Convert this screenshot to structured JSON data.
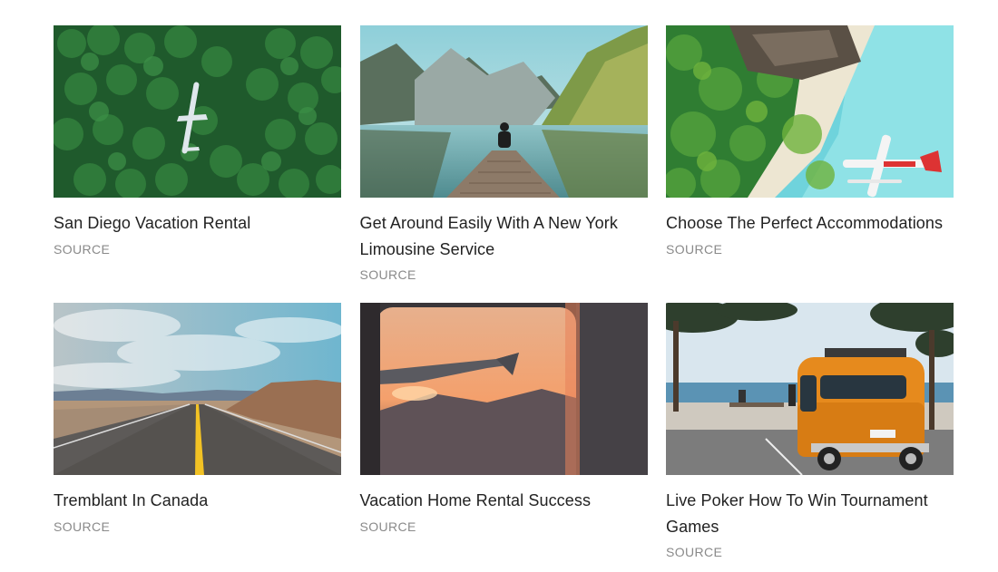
{
  "cards": [
    {
      "title": "San Diego Vacation Rental",
      "source": "SOURCE",
      "image": "aerial-forest-airplane"
    },
    {
      "title": "Get Around Easily With A New York Limousine Service",
      "source": "SOURCE",
      "image": "mountain-lake-pier"
    },
    {
      "title": "Choose The Perfect Accommodations",
      "source": "SOURCE",
      "image": "tropical-beach-seaplane"
    },
    {
      "title": "Tremblant In Canada",
      "source": "SOURCE",
      "image": "desert-highway"
    },
    {
      "title": "Vacation Home Rental Success",
      "source": "SOURCE",
      "image": "airplane-window-sunset"
    },
    {
      "title": "Live Poker How To Win Tournament Games",
      "source": "SOURCE",
      "image": "beach-orange-van"
    }
  ]
}
